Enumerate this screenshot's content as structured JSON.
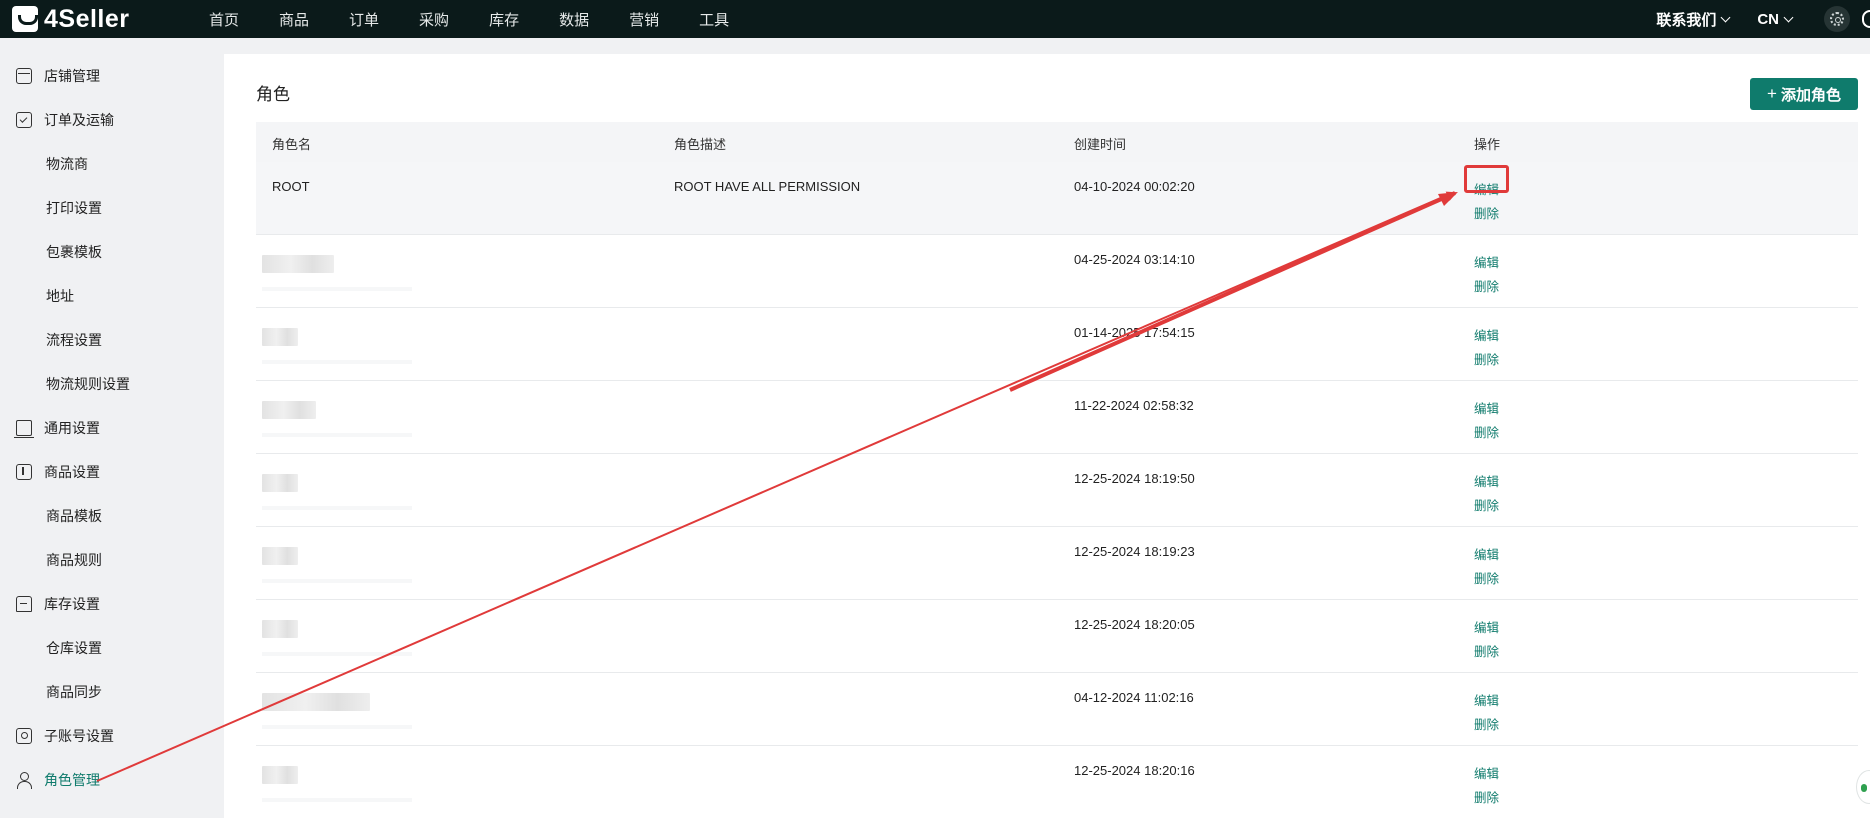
{
  "app": {
    "logo_text": "4Seller",
    "nav": [
      "首页",
      "商品",
      "订单",
      "采购",
      "库存",
      "数据",
      "营销",
      "工具"
    ],
    "contact_label": "联系我们",
    "lang_label": "CN"
  },
  "sidebar": {
    "items": [
      {
        "label": "店铺管理",
        "icon": "store-icon"
      },
      {
        "label": "订单及运输",
        "icon": "order-icon"
      },
      {
        "label": "物流商"
      },
      {
        "label": "打印设置"
      },
      {
        "label": "包裹模板"
      },
      {
        "label": "地址"
      },
      {
        "label": "流程设置"
      },
      {
        "label": "物流规则设置"
      },
      {
        "label": "通用设置",
        "icon": "general-settings-icon"
      },
      {
        "label": "商品设置",
        "icon": "product-settings-icon"
      },
      {
        "label": "商品模板"
      },
      {
        "label": "商品规则"
      },
      {
        "label": "库存设置",
        "icon": "stock-settings-icon"
      },
      {
        "label": "仓库设置"
      },
      {
        "label": "商品同步"
      },
      {
        "label": "子账号设置",
        "icon": "sub-account-icon"
      },
      {
        "label": "角色管理",
        "icon": "role-icon",
        "active": true
      }
    ]
  },
  "main": {
    "title": "角色",
    "add_button": "添加角色",
    "columns": [
      "角色名",
      "角色描述",
      "创建时间",
      "操作"
    ],
    "rows": [
      {
        "name": "ROOT",
        "desc": "ROOT HAVE ALL PERMISSION",
        "created": "04-10-2024 00:02:20"
      },
      {
        "name": "",
        "desc": "",
        "created": "04-25-2024 03:14:10"
      },
      {
        "name": "",
        "desc": "",
        "created": "01-14-2025 17:54:15"
      },
      {
        "name": "",
        "desc": "",
        "created": "11-22-2024 02:58:32"
      },
      {
        "name": "",
        "desc": "",
        "created": "12-25-2024 18:19:50"
      },
      {
        "name": "",
        "desc": "",
        "created": "12-25-2024 18:19:23"
      },
      {
        "name": "",
        "desc": "",
        "created": "12-25-2024 18:20:05"
      },
      {
        "name": "",
        "desc": "",
        "created": "04-12-2024 11:02:16"
      },
      {
        "name": "",
        "desc": "",
        "created": "12-25-2024 18:20:16"
      }
    ],
    "edit_label": "编辑",
    "delete_label": "删除"
  },
  "colors": {
    "accent": "#0f7b6c",
    "topbar": "#0b1a1a",
    "annotation": "#e03a3a"
  }
}
